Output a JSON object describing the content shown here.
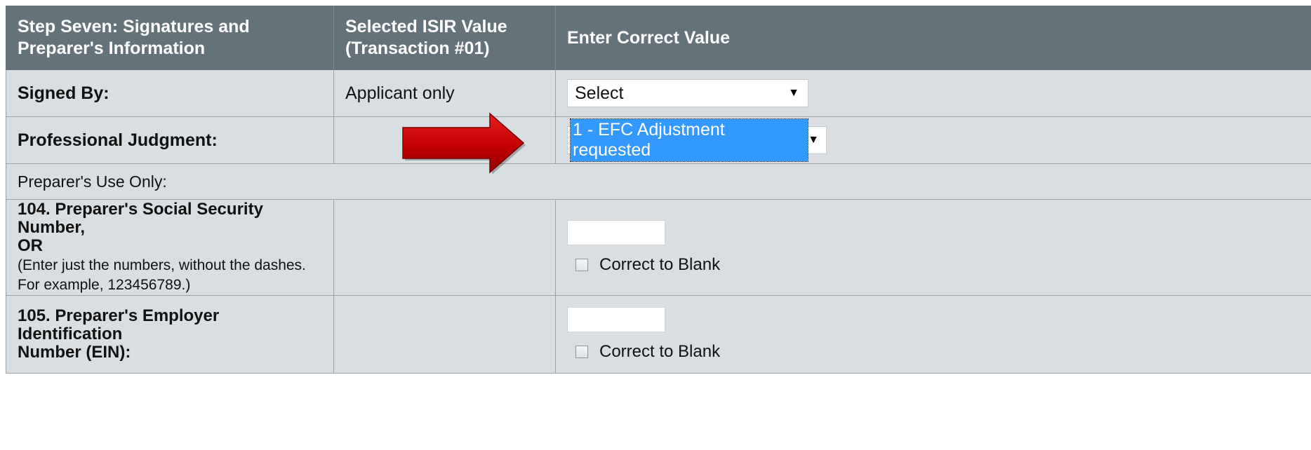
{
  "header": {
    "col1": [
      "Step Seven: Signatures and",
      "Preparer's Information"
    ],
    "col2": [
      "Selected ISIR Value",
      "(Transaction #01)"
    ],
    "col3": "Enter Correct Value"
  },
  "signed_by": {
    "label": "Signed By:",
    "isir_value": "Applicant only",
    "select_value": "Select"
  },
  "professional_judgment": {
    "label": "Professional Judgment:",
    "isir_value": "",
    "select_value": "1 - EFC Adjustment requested"
  },
  "preparer_section": {
    "label": "Preparer's Use Only:"
  },
  "preparer_ssn": {
    "label_line1": "104. Preparer's Social Security Number,",
    "label_line2": "OR",
    "hint_line1": "(Enter just the numbers, without the dashes.",
    "hint_line2": "For example, 123456789.)",
    "input_value": "",
    "checkbox_label": "Correct to Blank"
  },
  "preparer_ein": {
    "label_line1": "105. Preparer's Employer Identification",
    "label_line2": "Number (EIN):",
    "input_value": "",
    "checkbox_label": "Correct to Blank"
  },
  "icons": {
    "dropdown": "chevron-down-icon",
    "annotation": "arrow-right-icon"
  },
  "colors": {
    "header_bg": "#64737a",
    "row_bg": "#d8dee1",
    "highlight": "#3399ff",
    "arrow": "#cc0000"
  }
}
